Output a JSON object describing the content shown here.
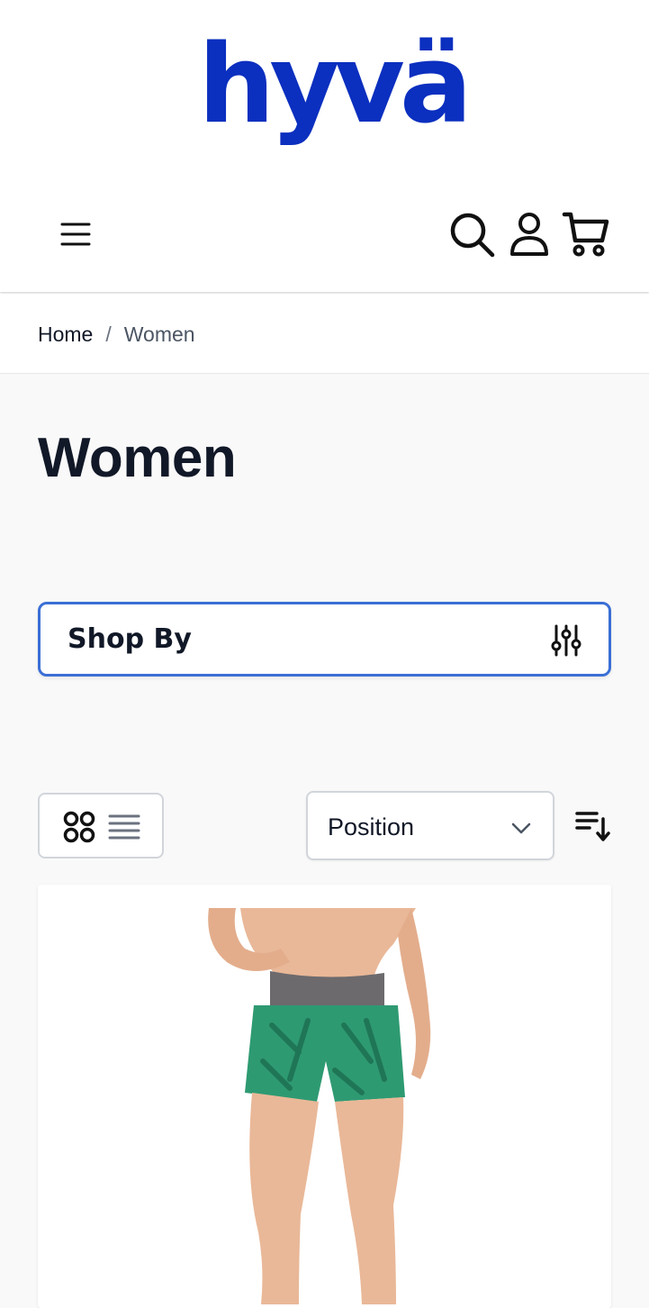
{
  "header": {
    "logo_text": "hyvä",
    "menu_icon": "hamburger-menu-icon",
    "search_icon": "search-icon",
    "account_icon": "user-account-icon",
    "cart_icon": "shopping-cart-icon",
    "brand_color": "#0b2fbf"
  },
  "breadcrumb": {
    "home": "Home",
    "separator": "/",
    "current": "Women"
  },
  "page": {
    "title": "Women"
  },
  "filters": {
    "shop_by_label": "Shop By",
    "shop_by_icon": "sliders-filter-icon",
    "border_color": "#3b6fd6"
  },
  "toolbar": {
    "grid_view_icon": "grid-view-icon",
    "list_view_icon": "list-view-icon",
    "sort_selected": "Position",
    "sort_chevron_icon": "chevron-down-icon",
    "sort_direction_icon": "sort-descending-icon"
  },
  "product": {
    "image_icon": "product-image-green-shorts"
  }
}
